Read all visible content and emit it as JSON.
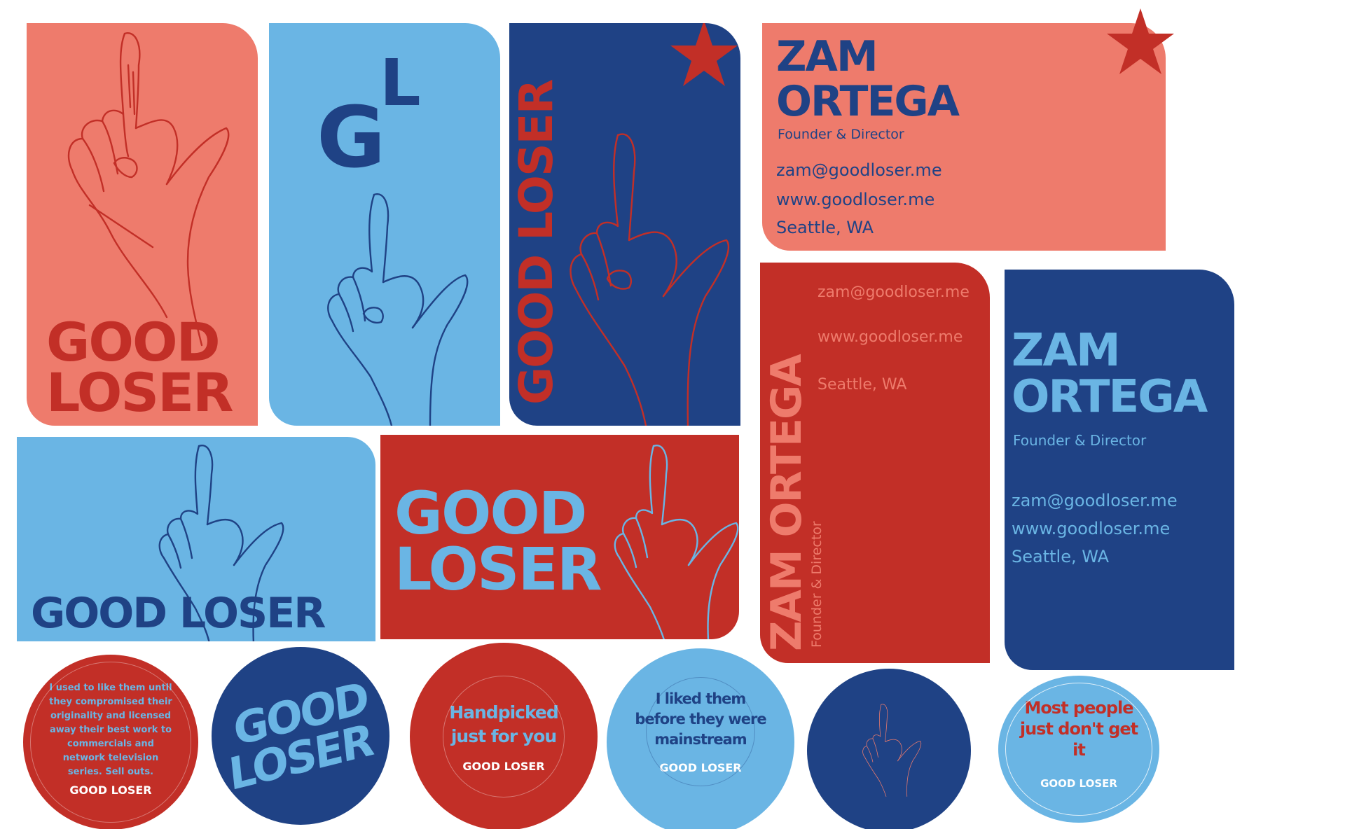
{
  "colors": {
    "salmon": "#EE7B6C",
    "sky": "#6AB5E4",
    "navy": "#1F4285",
    "red": "#C22F27",
    "white": "#FFFFFF"
  },
  "icons": [
    "star-icon",
    "hand-l-sign-icon"
  ],
  "brand": {
    "line1": "GOOD",
    "line2": "LOSER",
    "full": "GOOD LOSER",
    "mono_g": "G",
    "mono_l": "L"
  },
  "contact": {
    "first": "ZAM",
    "last": "ORTEGA",
    "full": "ZAM ORTEGA",
    "role": "Founder & Director",
    "email": "zam@goodloser.me",
    "web": "www.goodloser.me",
    "city": "Seattle, WA"
  },
  "stickers": {
    "s1_text": "I used to like them until they compromised their originality and licensed away their best work to commercials and network television series. Sell outs.",
    "s2_line1": "GOOD",
    "s2_line2": "LOSER",
    "s3_text": "Handpicked just for you",
    "s4_text": "I liked them before they were mainstream",
    "s6_text": "Most people just don't get it",
    "footer": "GOOD LOSER"
  }
}
